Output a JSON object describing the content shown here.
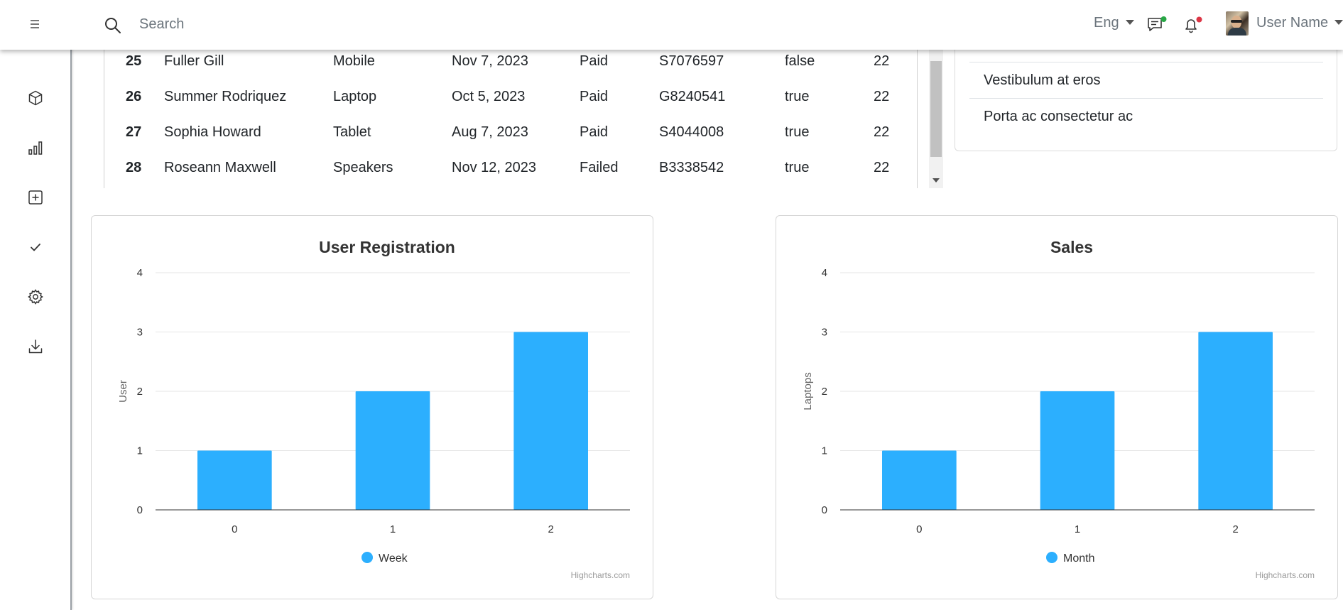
{
  "topbar": {
    "search_placeholder": "Search",
    "language": "Eng",
    "user_name": "User Name",
    "message_badge_color": "#28a745",
    "notification_badge_color": "#dc3545"
  },
  "sidebar": {
    "items": [
      {
        "icon": "box-icon"
      },
      {
        "icon": "bar-chart-icon"
      },
      {
        "icon": "plus-square-icon"
      },
      {
        "icon": "check-icon"
      },
      {
        "icon": "gear-icon"
      },
      {
        "icon": "download-icon"
      }
    ]
  },
  "table": {
    "rows": [
      {
        "id": "25",
        "name": "Fuller Gill",
        "device": "Mobile",
        "date": "Nov 7, 2023",
        "status": "Paid",
        "code": "S7076597",
        "flag": "false",
        "qty": "22"
      },
      {
        "id": "26",
        "name": "Summer Rodriquez",
        "device": "Laptop",
        "date": "Oct 5, 2023",
        "status": "Paid",
        "code": "G8240541",
        "flag": "true",
        "qty": "22"
      },
      {
        "id": "27",
        "name": "Sophia Howard",
        "device": "Tablet",
        "date": "Aug 7, 2023",
        "status": "Paid",
        "code": "S4044008",
        "flag": "true",
        "qty": "22"
      },
      {
        "id": "28",
        "name": "Roseann Maxwell",
        "device": "Speakers",
        "date": "Nov 12, 2023",
        "status": "Failed",
        "code": "B3338542",
        "flag": "true",
        "qty": "22"
      }
    ]
  },
  "list": {
    "items": [
      "Porta ac consectetur ac",
      "Vestibulum at eros",
      "Porta ac consectetur ac"
    ]
  },
  "chart_data": [
    {
      "type": "bar",
      "title": "User Registration",
      "xlabel": "",
      "ylabel": "User",
      "categories": [
        "0",
        "1",
        "2"
      ],
      "yticks": [
        "0",
        "1",
        "2",
        "3",
        "4"
      ],
      "ylim": [
        0,
        4
      ],
      "series": [
        {
          "name": "Week",
          "values": [
            1,
            2,
            3
          ],
          "color": "#2caffe"
        }
      ],
      "credits": "Highcharts.com",
      "grid": true,
      "legend": "bottom-center"
    },
    {
      "type": "bar",
      "title": "Sales",
      "xlabel": "",
      "ylabel": "Laptops",
      "categories": [
        "0",
        "1",
        "2"
      ],
      "yticks": [
        "0",
        "1",
        "2",
        "3",
        "4"
      ],
      "ylim": [
        0,
        4
      ],
      "series": [
        {
          "name": "Month",
          "values": [
            1,
            2,
            3
          ],
          "color": "#2caffe"
        }
      ],
      "credits": "Highcharts.com",
      "grid": true,
      "legend": "bottom-center"
    }
  ]
}
